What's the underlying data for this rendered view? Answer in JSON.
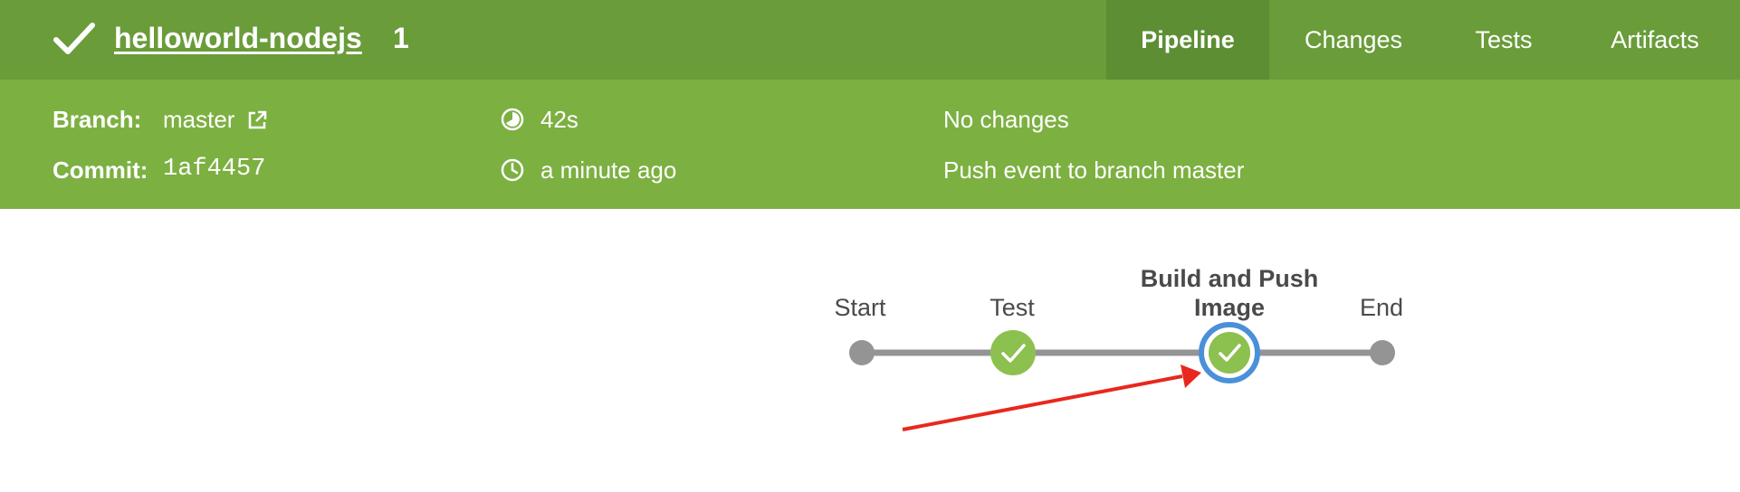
{
  "header": {
    "status_icon": "checkmark-icon",
    "title": "helloworld-nodejs",
    "run_number": "1",
    "tabs": [
      {
        "label": "Pipeline",
        "active": true
      },
      {
        "label": "Changes",
        "active": false
      },
      {
        "label": "Tests",
        "active": false
      },
      {
        "label": "Artifacts",
        "active": false
      }
    ]
  },
  "info": {
    "branch_label": "Branch:",
    "branch_value": "master",
    "commit_label": "Commit:",
    "commit_value": "1af4457",
    "duration": "42s",
    "started": "a minute ago",
    "changes": "No changes",
    "cause": "Push event to branch master"
  },
  "pipeline": {
    "stages": [
      {
        "label": "Start",
        "state": "node"
      },
      {
        "label": "Test",
        "state": "success"
      },
      {
        "label": "Build and Push Image",
        "state": "success-selected"
      },
      {
        "label": "End",
        "state": "node"
      }
    ]
  },
  "colors": {
    "header_green": "#6a9c3a",
    "info_green": "#7cb041",
    "success_green": "#8cc04f",
    "selected_ring": "#4a90d9",
    "annotation_arrow": "#e8281e"
  }
}
